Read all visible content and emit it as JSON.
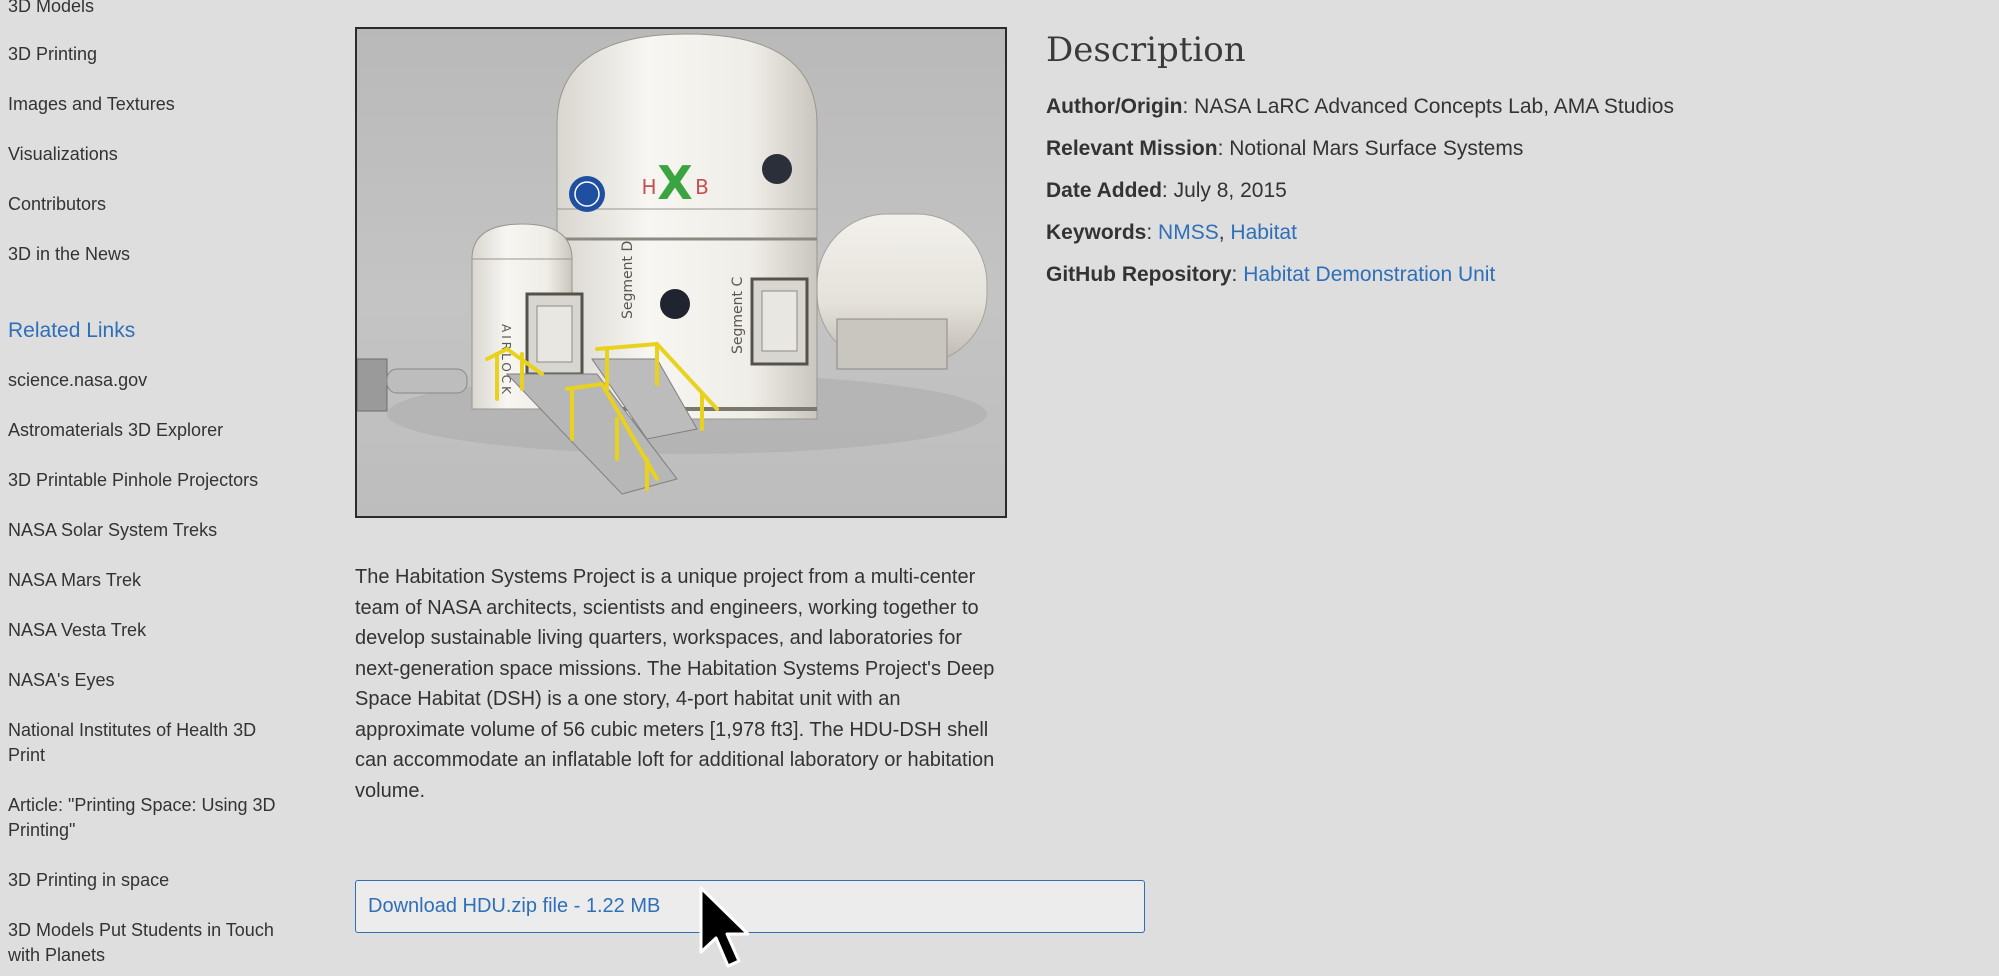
{
  "sidebar": {
    "items_top": [
      "3D Models",
      "3D Printing",
      "Images and Textures",
      "Visualizations",
      "Contributors",
      "3D in the News"
    ],
    "related_heading": "Related Links",
    "related_links": [
      "science.nasa.gov",
      "Astromaterials 3D Explorer",
      "3D Printable Pinhole Projectors",
      "NASA Solar System Treks",
      "NASA Mars Trek",
      "NASA Vesta Trek",
      "NASA's Eyes",
      "National Institutes of Health 3D Print",
      "Article: \"Printing Space: Using 3D Printing\"",
      "3D Printing in space",
      "3D Models Put Students in Touch with Planets"
    ]
  },
  "main": {
    "description": "The Habitation Systems Project is a unique project from a multi-center team of NASA architects, scientists and engineers, working together to develop sustainable living quarters, workspaces, and laboratories for next-generation space missions. The Habitation Systems Project's Deep Space Habitat (DSH) is a one story, 4-port habitat unit with an approximate volume of 56 cubic meters [1,978 ft3]. The HDU-DSH shell can accommodate an inflatable loft for additional laboratory or habitation volume.",
    "download_label": "Download HDU.zip file - 1.22 MB"
  },
  "details": {
    "title": "Description",
    "author_label": "Author/Origin",
    "author_value": "NASA LaRC Advanced Concepts Lab, AMA Studios",
    "mission_label": "Relevant Mission",
    "mission_value": "Notional Mars Surface Systems",
    "date_label": "Date Added",
    "date_value": "July 8, 2015",
    "keywords_label": "Keywords",
    "keywords": [
      "NMSS",
      "Habitat"
    ],
    "github_label": "GitHub Repository",
    "github_value": "Habitat Demonstration Unit"
  },
  "image_text": {
    "label_x": "X",
    "label_h": "H",
    "label_b": "B",
    "segment_d": "Segment D",
    "segment_c": "Segment C",
    "airlock": "AIRLOCK"
  },
  "colors": {
    "background": "#dedede",
    "link": "#2f6fb8",
    "text": "#333333",
    "hab_x_green": "#3aa540",
    "rail_yellow": "#e8d21e"
  }
}
